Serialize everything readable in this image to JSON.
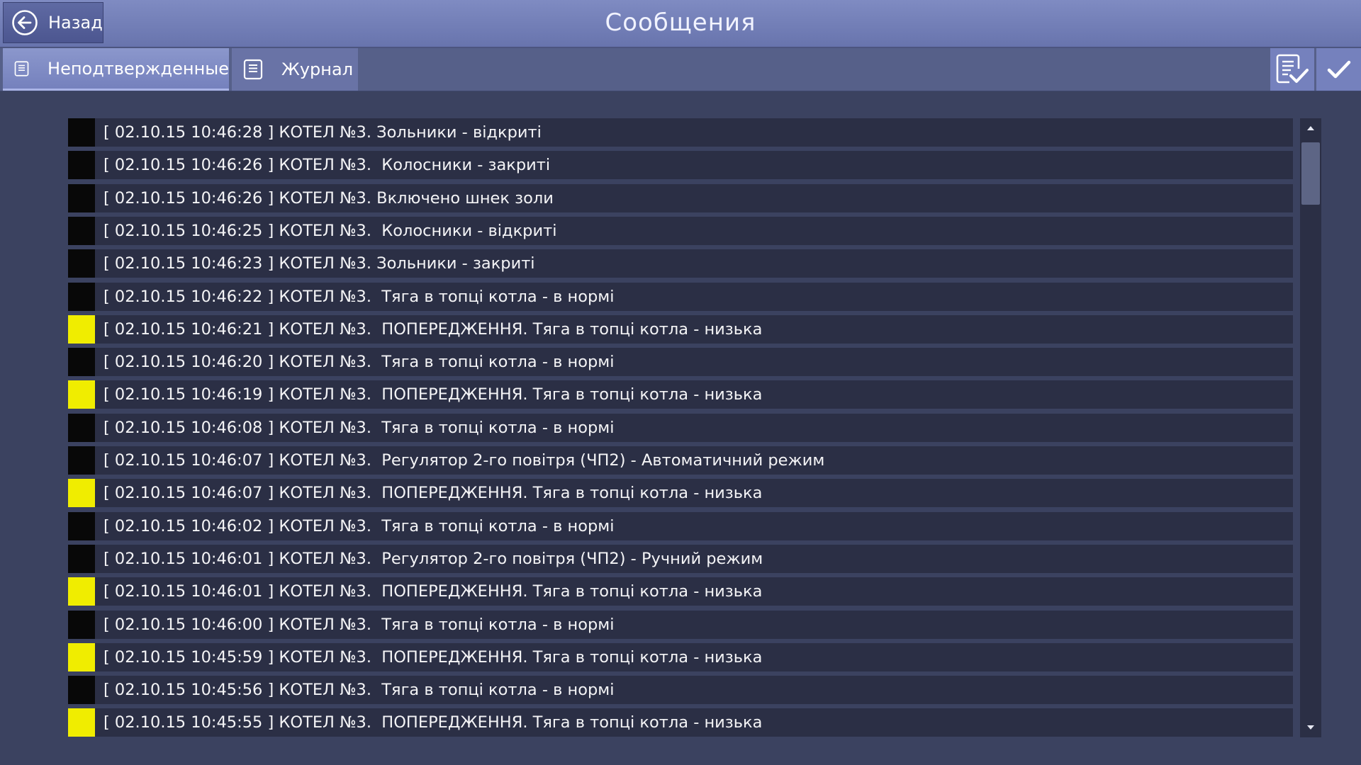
{
  "header": {
    "back_label": "Назад",
    "title": "Сообщения"
  },
  "tabs": [
    {
      "label": "Неподтвержденные",
      "active": true,
      "icon": "document-icon"
    },
    {
      "label": "Журнал",
      "active": false,
      "icon": "document-icon"
    }
  ],
  "toolbar": {
    "confirm_list_icon": "document-check-icon",
    "confirm_icon": "checkmark-icon"
  },
  "colors": {
    "info": "#080808",
    "warning": "#f0ed00",
    "row_bg": "#2b2f45",
    "page_bg": "#3b4260"
  },
  "messages": [
    {
      "severity": "info",
      "text": "[ 02.10.15 10:46:28 ] КОТЕЛ №3. Зольники - відкриті"
    },
    {
      "severity": "info",
      "text": "[ 02.10.15 10:46:26 ] КОТЕЛ №3.  Колосники - закриті"
    },
    {
      "severity": "info",
      "text": "[ 02.10.15 10:46:26 ] КОТЕЛ №3. Включено шнек золи"
    },
    {
      "severity": "info",
      "text": "[ 02.10.15 10:46:25 ] КОТЕЛ №3.  Колосники - відкриті"
    },
    {
      "severity": "info",
      "text": "[ 02.10.15 10:46:23 ] КОТЕЛ №3. Зольники - закриті"
    },
    {
      "severity": "info",
      "text": "[ 02.10.15 10:46:22 ] КОТЕЛ №3.  Тяга в топці котла - в нормі"
    },
    {
      "severity": "warning",
      "text": "[ 02.10.15 10:46:21 ] КОТЕЛ №3.  ПОПЕРЕДЖЕННЯ. Тяга в топці котла - низька"
    },
    {
      "severity": "info",
      "text": "[ 02.10.15 10:46:20 ] КОТЕЛ №3.  Тяга в топці котла - в нормі"
    },
    {
      "severity": "warning",
      "text": "[ 02.10.15 10:46:19 ] КОТЕЛ №3.  ПОПЕРЕДЖЕННЯ. Тяга в топці котла - низька"
    },
    {
      "severity": "info",
      "text": "[ 02.10.15 10:46:08 ] КОТЕЛ №3.  Тяга в топці котла - в нормі"
    },
    {
      "severity": "info",
      "text": "[ 02.10.15 10:46:07 ] КОТЕЛ №3.  Регулятор 2-го повітря (ЧП2) - Автоматичний режим"
    },
    {
      "severity": "warning",
      "text": "[ 02.10.15 10:46:07 ] КОТЕЛ №3.  ПОПЕРЕДЖЕННЯ. Тяга в топці котла - низька"
    },
    {
      "severity": "info",
      "text": "[ 02.10.15 10:46:02 ] КОТЕЛ №3.  Тяга в топці котла - в нормі"
    },
    {
      "severity": "info",
      "text": "[ 02.10.15 10:46:01 ] КОТЕЛ №3.  Регулятор 2-го повітря (ЧП2) - Ручний режим"
    },
    {
      "severity": "warning",
      "text": "[ 02.10.15 10:46:01 ] КОТЕЛ №3.  ПОПЕРЕДЖЕННЯ. Тяга в топці котла - низька"
    },
    {
      "severity": "info",
      "text": "[ 02.10.15 10:46:00 ] КОТЕЛ №3.  Тяга в топці котла - в нормі"
    },
    {
      "severity": "warning",
      "text": "[ 02.10.15 10:45:59 ] КОТЕЛ №3.  ПОПЕРЕДЖЕННЯ. Тяга в топці котла - низька"
    },
    {
      "severity": "info",
      "text": "[ 02.10.15 10:45:56 ] КОТЕЛ №3.  Тяга в топці котла - в нормі"
    },
    {
      "severity": "warning",
      "text": "[ 02.10.15 10:45:55 ] КОТЕЛ №3.  ПОПЕРЕДЖЕННЯ. Тяга в топці котла - низька"
    }
  ],
  "scrollbar": {
    "up_icon": "arrow-up-icon",
    "down_icon": "arrow-down-icon"
  }
}
